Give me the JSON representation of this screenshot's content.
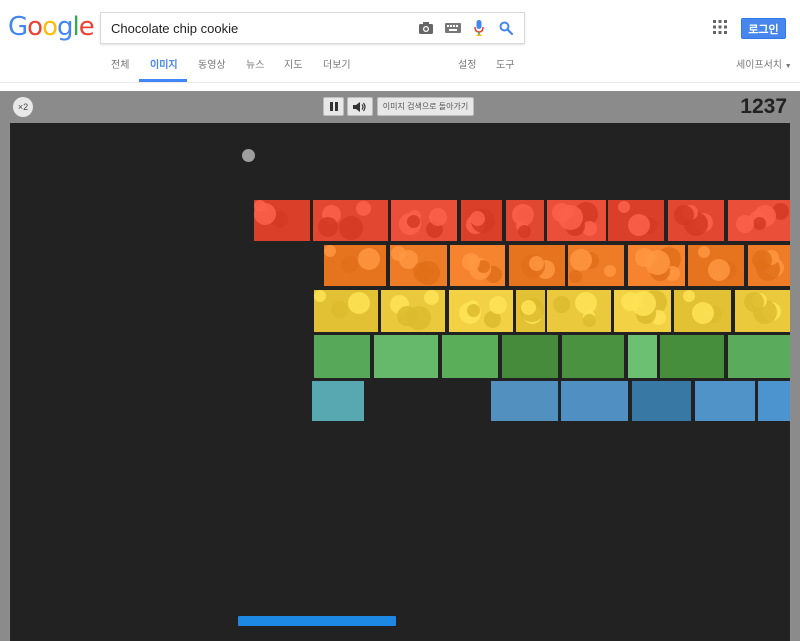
{
  "header": {
    "logo_letters": [
      {
        "ch": "G",
        "color": "#4285f4"
      },
      {
        "ch": "o",
        "color": "#ea4335"
      },
      {
        "ch": "o",
        "color": "#fbbc05"
      },
      {
        "ch": "g",
        "color": "#4285f4"
      },
      {
        "ch": "l",
        "color": "#34a853"
      },
      {
        "ch": "e",
        "color": "#ea4335"
      }
    ],
    "search_value": "Chocolate chip cookie",
    "search_icons": [
      "camera-icon",
      "keyboard-icon",
      "microphone-icon",
      "search-icon"
    ],
    "apps_icon": "apps-grid-icon",
    "login_label": "로그인"
  },
  "nav": {
    "tabs": [
      {
        "label": "전체",
        "active": false
      },
      {
        "label": "이미지",
        "active": true
      },
      {
        "label": "동영상",
        "active": false
      },
      {
        "label": "뉴스",
        "active": false
      },
      {
        "label": "지도",
        "active": false
      },
      {
        "label": "더보기",
        "active": false
      }
    ],
    "settings_label": "설정",
    "tools_label": "도구",
    "safesearch_label": "세이프서치"
  },
  "game": {
    "speed_label": "×2",
    "pause_icon": "pause-icon",
    "sound_icon": "speaker-icon",
    "back_label": "이미지 검색으로 돌아가기",
    "score": "1237",
    "rows": [
      {
        "color": "#e0462f",
        "kind": "photo"
      },
      {
        "color": "#ec7a25",
        "kind": "photo"
      },
      {
        "color": "#e8c73a",
        "kind": "photo"
      },
      {
        "color": "#4fa84f",
        "kind": "solid"
      },
      {
        "color": "#4a93c2",
        "kind": "solid"
      }
    ]
  }
}
